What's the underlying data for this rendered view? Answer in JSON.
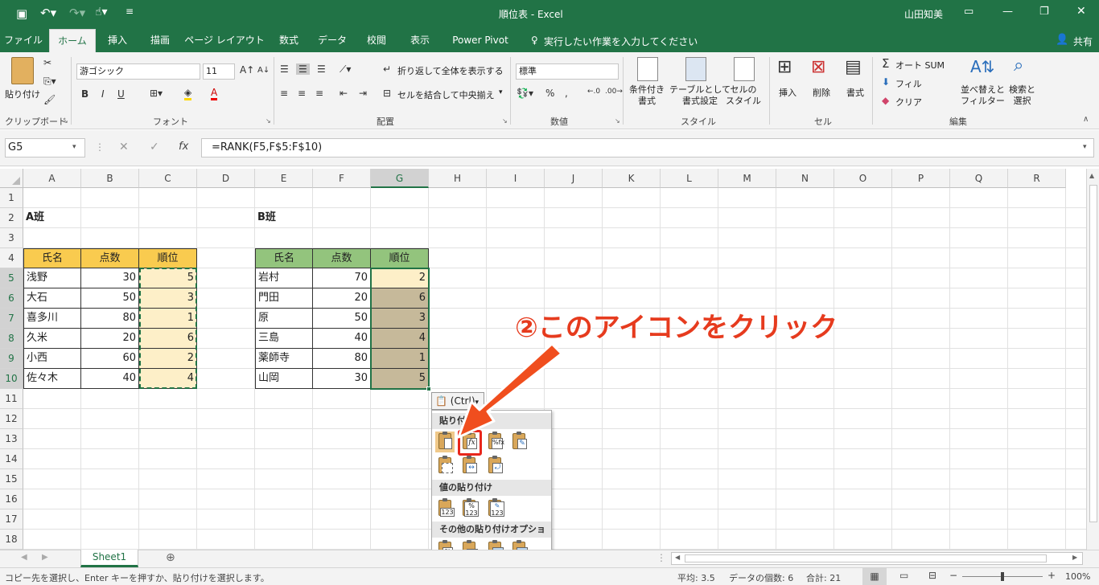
{
  "window": {
    "title": "順位表 - Excel",
    "user": "山田知美"
  },
  "tabs": [
    "ファイル",
    "ホーム",
    "挿入",
    "描画",
    "ページ レイアウト",
    "数式",
    "データ",
    "校閲",
    "表示",
    "Power Pivot"
  ],
  "active_tab": "ホーム",
  "tell_me": "実行したい作業を入力してください",
  "share": "共有",
  "ribbon": {
    "clipboard": {
      "paste": "貼り付け",
      "label": "クリップボード"
    },
    "font": {
      "name": "游ゴシック",
      "size": "11",
      "label": "フォント",
      "bold": "B",
      "italic": "I",
      "underline": "U"
    },
    "alignment": {
      "wrap": "折り返して全体を表示する",
      "merge": "セルを結合して中央揃え",
      "label": "配置"
    },
    "number": {
      "format": "標準",
      "label": "数値"
    },
    "styles": {
      "conditional": "条件付き\n書式",
      "table": "テーブルとして\n書式設定",
      "cell": "セルの\nスタイル",
      "label": "スタイル"
    },
    "cells": {
      "insert": "挿入",
      "delete": "削除",
      "format": "書式",
      "label": "セル"
    },
    "editing": {
      "autosum": "オート SUM",
      "fill": "フィル",
      "clear": "クリア",
      "sort": "並べ替えと\nフィルター",
      "find": "検索と\n選択",
      "label": "編集"
    }
  },
  "formula_bar": {
    "name_box": "G5",
    "formula": "=RANK(F5,F$5:F$10)"
  },
  "columns": [
    "A",
    "B",
    "C",
    "D",
    "E",
    "F",
    "G",
    "H",
    "I",
    "J",
    "K",
    "L",
    "M",
    "N",
    "O",
    "P",
    "Q",
    "R"
  ],
  "rows": [
    "1",
    "2",
    "3",
    "4",
    "5",
    "6",
    "7",
    "8",
    "9",
    "10",
    "11",
    "12",
    "13",
    "14",
    "15",
    "16",
    "17",
    "18"
  ],
  "groupA": {
    "title": "A班",
    "headers": [
      "氏名",
      "点数",
      "順位"
    ],
    "rows": [
      [
        "浅野",
        "30",
        "5"
      ],
      [
        "大石",
        "50",
        "3"
      ],
      [
        "喜多川",
        "80",
        "1"
      ],
      [
        "久米",
        "20",
        "6"
      ],
      [
        "小西",
        "60",
        "2"
      ],
      [
        "佐々木",
        "40",
        "4"
      ]
    ]
  },
  "groupB": {
    "title": "B班",
    "headers": [
      "氏名",
      "点数",
      "順位"
    ],
    "rows": [
      [
        "岩村",
        "70",
        "2"
      ],
      [
        "門田",
        "20",
        "6"
      ],
      [
        "原",
        "50",
        "3"
      ],
      [
        "三島",
        "40",
        "4"
      ],
      [
        "薬師寺",
        "80",
        "1"
      ],
      [
        "山岡",
        "30",
        "5"
      ]
    ]
  },
  "paste_options": {
    "button": "(Ctrl)",
    "section_paste": "貼り付け",
    "section_values": "値の貼り付け",
    "section_other": "その他の貼り付けオプション"
  },
  "annotation": "②このアイコンをクリック",
  "sheet_tab": "Sheet1",
  "status": {
    "message": "コピー先を選択し、Enter キーを押すか、貼り付けを選択します。",
    "average": "平均: 3.5",
    "count": "データの個数: 6",
    "sum": "合計: 21",
    "zoom": "100%"
  },
  "colors": {
    "excel_green": "#217346",
    "a_header": "#f9cb4f",
    "a_rank": "#fdefc8",
    "b_header": "#93c47d",
    "b_rank": "#c6b99a",
    "annotation": "#e63b1e"
  }
}
